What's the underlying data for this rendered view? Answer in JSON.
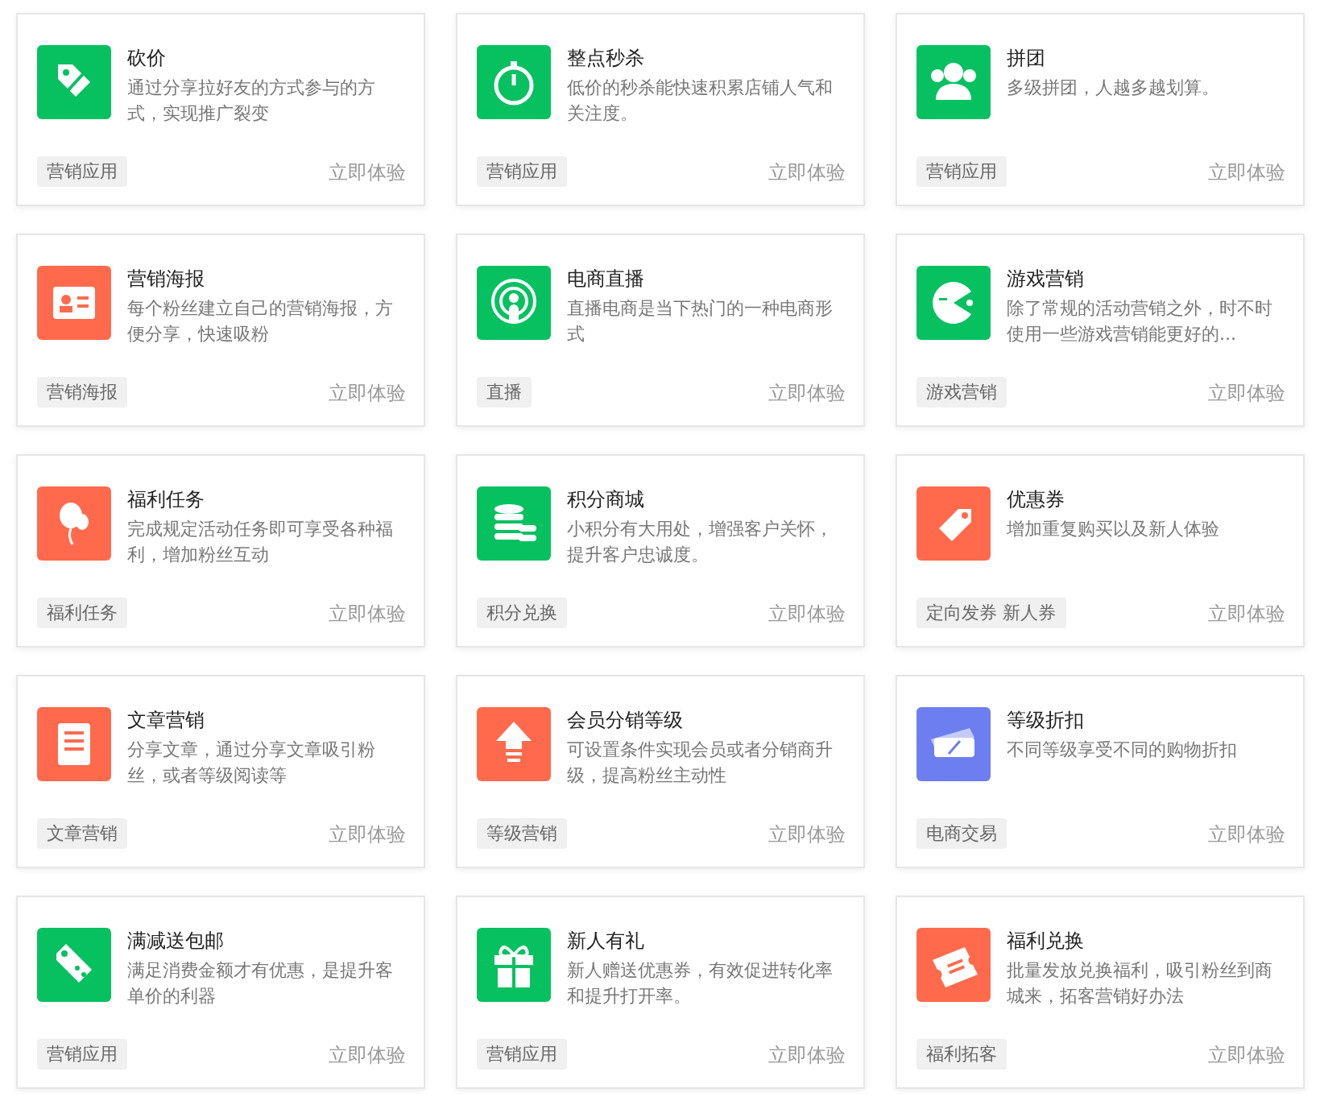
{
  "cards": [
    {
      "title": "砍价",
      "description": "通过分享拉好友的方式参与的方式，实现推广裂变",
      "tag": "营销应用",
      "action": "立即体验",
      "kind": "tag",
      "color": "#07c160"
    },
    {
      "title": "整点秒杀",
      "description": "低价的秒杀能快速积累店铺人气和关注度。",
      "tag": "营销应用",
      "action": "立即体验",
      "kind": "stopwatch",
      "color": "#07c160"
    },
    {
      "title": "拼团",
      "description": "多级拼团，人越多越划算。",
      "tag": "营销应用",
      "action": "立即体验",
      "kind": "people",
      "color": "#07c160"
    },
    {
      "title": "营销海报",
      "description": "每个粉丝建立自己的营销海报，方便分享，快速吸粉",
      "tag": "营销海报",
      "action": "立即体验",
      "kind": "id-card",
      "color": "#ff6a4d"
    },
    {
      "title": "电商直播",
      "description": "直播电商是当下热门的一种电商形式",
      "tag": "直播",
      "action": "立即体验",
      "kind": "broadcast",
      "color": "#07c160"
    },
    {
      "title": "游戏营销",
      "description": "除了常规的活动营销之外，时不时使用一些游戏营销能更好的...",
      "tag": "游戏营销",
      "action": "立即体验",
      "kind": "pacman",
      "color": "#07c160"
    },
    {
      "title": "福利任务",
      "description": "完成规定活动任务即可享受各种福利，增加粉丝互动",
      "tag": "福利任务",
      "action": "立即体验",
      "kind": "balloon",
      "color": "#ff6a4d"
    },
    {
      "title": "积分商城",
      "description": "小积分有大用处，增强客户关怀，提升客户忠诚度。",
      "tag": "积分兑换",
      "action": "立即体验",
      "kind": "coins",
      "color": "#07c160"
    },
    {
      "title": "优惠券",
      "description": "增加重复购买以及新人体验",
      "tag": "定向发券 新人券",
      "action": "立即体验",
      "kind": "coupon",
      "color": "#ff6a4d"
    },
    {
      "title": "文章营销",
      "description": "分享文章，通过分享文章吸引粉丝，或者等级阅读等",
      "tag": "文章营销",
      "action": "立即体验",
      "kind": "scroll",
      "color": "#ff6a4d"
    },
    {
      "title": "会员分销等级",
      "description": "可设置条件实现会员或者分销商升级，提高粉丝主动性",
      "tag": "等级营销",
      "action": "立即体验",
      "kind": "arrow",
      "color": "#ff6a4d"
    },
    {
      "title": "等级折扣",
      "description": "不同等级享受不同的购物折扣",
      "tag": "电商交易",
      "action": "立即体验",
      "kind": "discount",
      "color": "#6c7ef0"
    },
    {
      "title": "满减送包邮",
      "description": "满足消费金额才有优惠，是提升客单价的利器",
      "tag": "营销应用",
      "action": "立即体验",
      "kind": "price-tag",
      "color": "#07c160"
    },
    {
      "title": "新人有礼",
      "description": "新人赠送优惠券，有效促进转化率和提升打开率。",
      "tag": "营销应用",
      "action": "立即体验",
      "kind": "gift",
      "color": "#07c160"
    },
    {
      "title": "福利兑换",
      "description": "批量发放兑换福利，吸引粉丝到商城来，拓客营销好办法",
      "tag": "福利拓客",
      "action": "立即体验",
      "kind": "ticket",
      "color": "#ff6a4d"
    }
  ]
}
